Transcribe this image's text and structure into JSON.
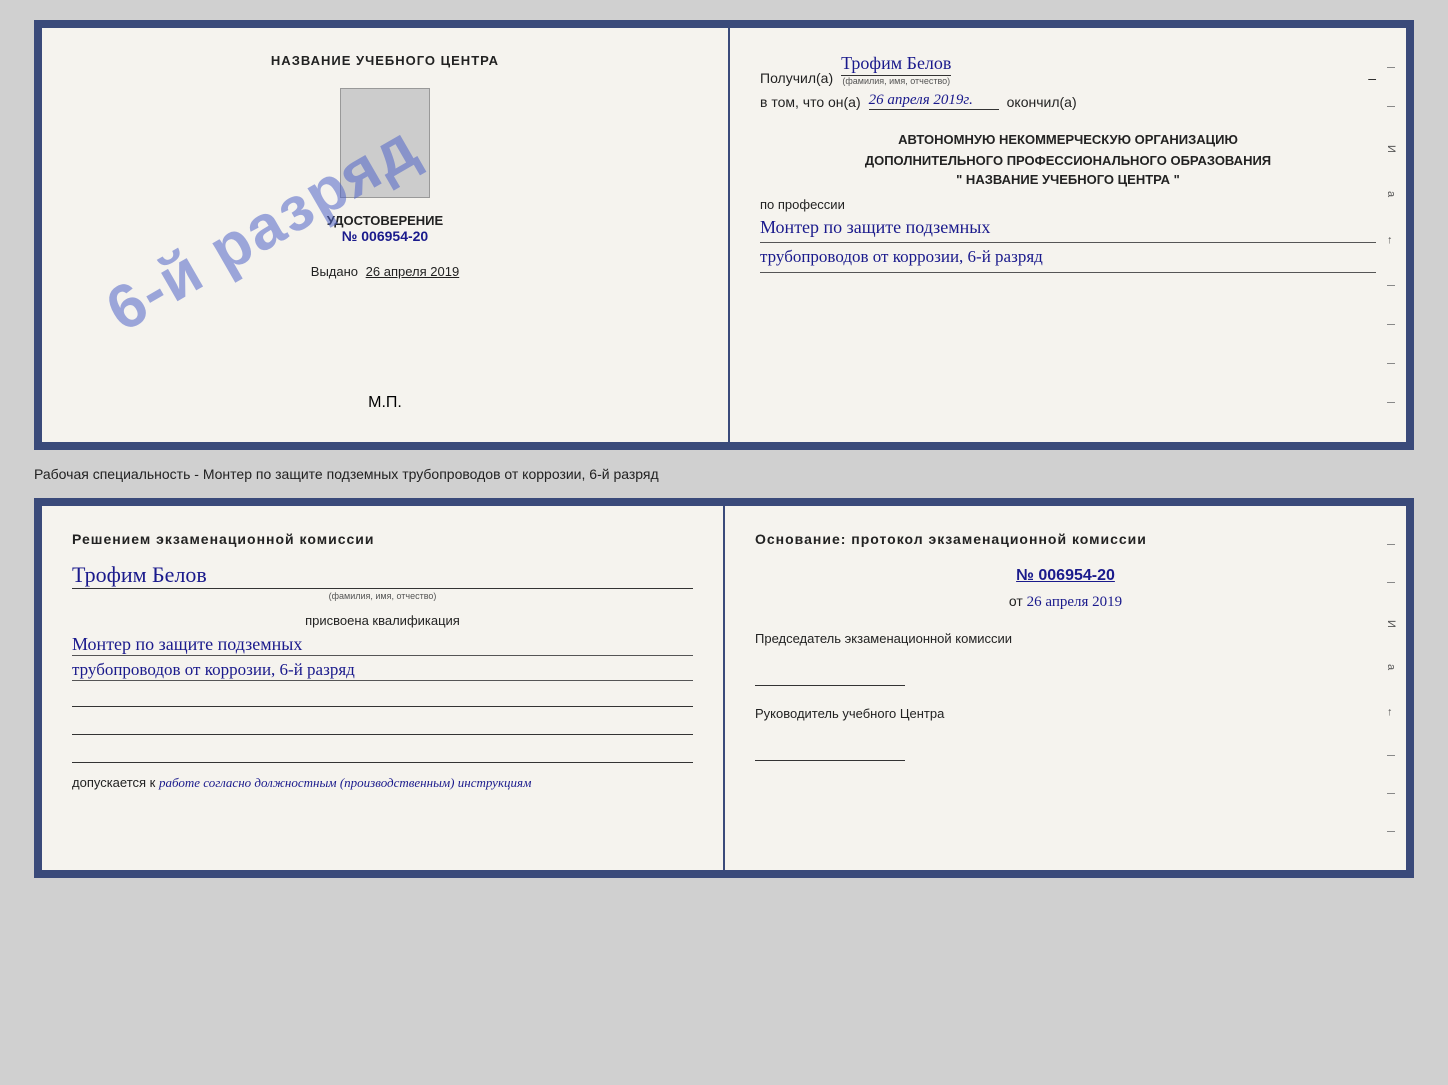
{
  "page": {
    "background": "#d0d0d0"
  },
  "top_doc": {
    "left": {
      "institution_title": "НАЗВАНИЕ УЧЕБНОГО ЦЕНТРА",
      "cert_label": "УДОСТОВЕРЕНИЕ",
      "cert_number": "№ 006954-20",
      "issued_label": "Выдано",
      "issued_date": "26 апреля 2019",
      "mp_label": "М.П.",
      "stamp_text": "6-й разряд"
    },
    "right": {
      "received_label": "Получил(а)",
      "recipient_name": "Трофим Белов",
      "recipient_sublabel": "(фамилия, имя, отчество)",
      "dash": "–",
      "date_intro": "в том, что он(а)",
      "date_value": "26 апреля 2019г.",
      "completed_label": "окончил(а)",
      "org_line1": "АВТОНОМНУЮ НЕКОММЕРЧЕСКУЮ ОРГАНИЗАЦИЮ",
      "org_line2": "ДОПОЛНИТЕЛЬНОГО ПРОФЕССИОНАЛЬНОГО ОБРАЗОВАНИЯ",
      "org_name": "\"   НАЗВАНИЕ УЧЕБНОГО ЦЕНТРА   \"",
      "profession_label": "по профессии",
      "profession_line1": "Монтер по защите подземных",
      "profession_line2": "трубопроводов от коррозии, 6-й разряд"
    }
  },
  "specialty_label": "Рабочая специальность - Монтер по защите подземных трубопроводов от коррозии, 6-й разряд",
  "bottom_doc": {
    "left": {
      "commission_title": "Решением экзаменационной комиссии",
      "person_name": "Трофим Белов",
      "person_sublabel": "(фамилия, имя, отчество)",
      "qualification_label": "присвоена квалификация",
      "qual_line1": "Монтер по защите подземных",
      "qual_line2": "трубопроводов от коррозии, 6-й разряд",
      "blank_line1": "",
      "blank_line2": "",
      "blank_line3": "",
      "admission_label": "допускается к",
      "admission_text": "работе согласно должностным (производственным) инструкциям"
    },
    "right": {
      "basis_title": "Основание: протокол экзаменационной комиссии",
      "protocol_number": "№  006954-20",
      "date_prefix": "от",
      "date_value": "26 апреля 2019",
      "chairman_label": "Председатель экзаменационной комиссии",
      "director_label": "Руководитель учебного Центра"
    }
  }
}
